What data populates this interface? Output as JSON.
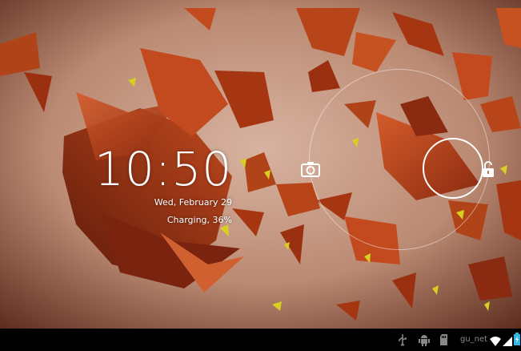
{
  "lockscreen": {
    "time": "10:50",
    "date": "Wed, February 29",
    "charging_status": "Charging, 36%"
  },
  "unlock_widget": {
    "camera_icon": "camera-icon",
    "unlock_icon": "unlock-padlock-icon"
  },
  "status_bar": {
    "icons": [
      "usb-icon",
      "android-debug-icon",
      "sd-card-icon",
      "wifi-icon",
      "signal-icon",
      "battery-icon"
    ],
    "network_name": "gu_net"
  },
  "colors": {
    "background_warm": "#c08a70",
    "shard": "#b8441a",
    "shard_dark": "#7a2410",
    "accent_yellow": "#d8d020",
    "status_bar": "#000000",
    "battery": "#33b5e5"
  }
}
